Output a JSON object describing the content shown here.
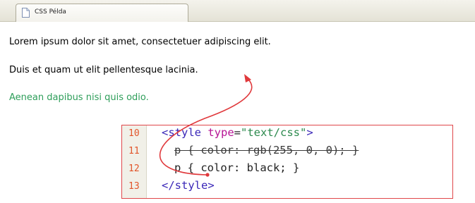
{
  "tab": {
    "title": "CSS Példa"
  },
  "content": {
    "paragraphs": [
      {
        "text": "Lorem ipsum dolor sit amet, consectetuer adipiscing elit.",
        "color": "#000000"
      },
      {
        "text": "Duis et quam ut elit pellentesque lacinia.",
        "color": "#000000"
      },
      {
        "text": "Aenean dapibus nisi quis odio.",
        "color": "#2e9e5a"
      }
    ]
  },
  "code": {
    "lines": [
      {
        "number": "10",
        "tag_open": "<style",
        "attr": " type",
        "eq": "=",
        "value": "\"text/css\"",
        "tag_close": ">"
      },
      {
        "number": "11",
        "text": "p { color: rgb(255, 0, 0); }",
        "struck_through": true
      },
      {
        "number": "12",
        "text": "p { color: black; }"
      },
      {
        "number": "13",
        "text": "</style>"
      }
    ]
  },
  "colors": {
    "annotation_arrow": "#e0393c",
    "line_numbers": "#e2552a",
    "code_box_border": "#e0474a"
  }
}
